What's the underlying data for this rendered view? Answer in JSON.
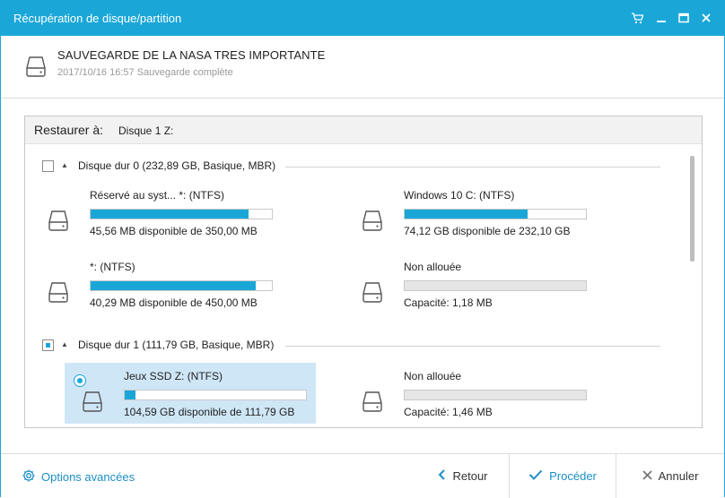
{
  "window": {
    "title": "Récupération de disque/partition",
    "controls": [
      "cart-icon",
      "minimize-icon",
      "maximize-icon",
      "close-icon"
    ]
  },
  "header": {
    "backup_name": "SAUVEGARDE DE LA NASA TRES IMPORTANTE",
    "backup_info": "2017/10/16 16:57 Sauvegarde complète"
  },
  "restore": {
    "label": "Restaurer à:",
    "target": "Disque 1 Z:"
  },
  "disks": [
    {
      "label": "Disque dur 0 (232,89 GB, Basique, MBR)",
      "checked": "unchecked",
      "partitions": [
        {
          "name": "Réservé au syst... *: (NTFS)",
          "info": "45,56 MB disponible de 350,00 MB",
          "used_fraction": 0.87,
          "selected": false
        },
        {
          "name": "Windows 10 C: (NTFS)",
          "info": "74,12 GB disponible de 232,10 GB",
          "used_fraction": 0.68,
          "selected": false
        },
        {
          "name": "*: (NTFS)",
          "info": "40,29 MB disponible de 450,00 MB",
          "used_fraction": 0.91,
          "selected": false
        },
        {
          "name": "Non allouée",
          "info": "Capacité: 1,18 MB",
          "used_fraction": 0,
          "selected": false
        }
      ]
    },
    {
      "label": "Disque dur 1 (111,79 GB, Basique, MBR)",
      "checked": "partial",
      "partitions": [
        {
          "name": "Jeux SSD Z: (NTFS)",
          "info": "104,59 GB disponible de 111,79 GB",
          "used_fraction": 0.06,
          "selected": true
        },
        {
          "name": "Non allouée",
          "info": "Capacité: 1,46 MB",
          "used_fraction": 0,
          "selected": false
        }
      ]
    }
  ],
  "footer": {
    "advanced_options": "Options avancées",
    "back": "Retour",
    "proceed": "Procéder",
    "cancel": "Annuler"
  },
  "colors": {
    "accent": "#1aa7d8",
    "selected_bg": "#cfe6f7",
    "link": "#1a8fc6"
  }
}
